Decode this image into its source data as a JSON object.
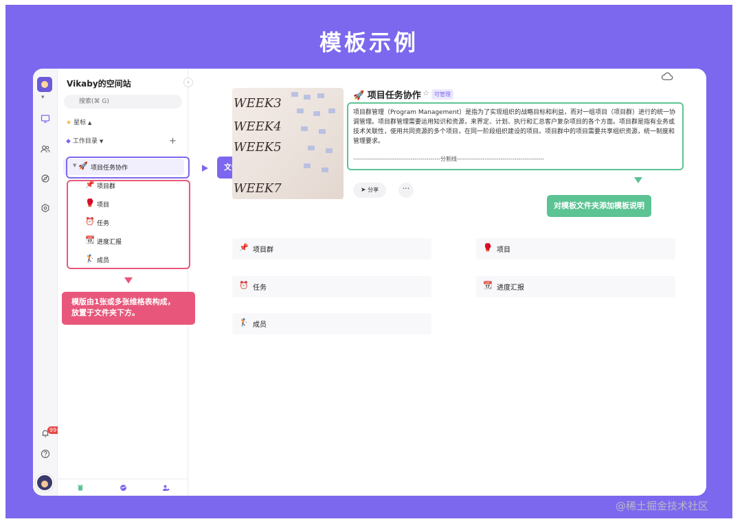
{
  "page_title": "模板示例",
  "workspace": {
    "name": "Vikaby的空间站",
    "search_placeholder": "搜索(⌘ G)",
    "starred_label": "星标",
    "catalog_label": "工作目录",
    "notification_count": "99+"
  },
  "folder": {
    "icon": "🚀",
    "label": "项目任务协作"
  },
  "sheets": [
    {
      "icon": "📌",
      "label": "项目群"
    },
    {
      "icon": "🥊",
      "label": "项目"
    },
    {
      "icon": "⏰",
      "label": "任务"
    },
    {
      "icon": "📆",
      "label": "进度汇报"
    },
    {
      "icon": "🏌",
      "label": "成员"
    }
  ],
  "annotations": {
    "folder_naming": "文件夹以模版名称命名",
    "sheets_note_line1": "模版由1张或多张维格表构成，",
    "sheets_note_line2": "放置于文件夹下方。",
    "description_note": "对模板文件夹添加模板说明"
  },
  "main": {
    "title": "🚀 项目任务协作",
    "permission_tag": "可管理",
    "description": "项目群管理（Program Management）是指为了实现组织的战略目标和利益，而对一组项目（项目群）进行的统一协调管理。项目群管理需要运用知识和资源，来界定、计划、执行和汇总客户复杂项目的各个方面。项目群是指有业务或技术关联性，使用共同资源的多个项目，在同一阶段组织建设的项目。项目群中的项目需要共享组织资源，统一制度和管理要求。",
    "divider_text": "--------------------------------------------分割线--------------------------------------------",
    "share_label": "分享",
    "more_label": "···",
    "cover_words": [
      "WEEK3",
      "WEEK4",
      "WEEK5",
      "WEEK7"
    ]
  },
  "cards": [
    {
      "icon": "📌",
      "label": "项目群"
    },
    {
      "icon": "🥊",
      "label": "项目"
    },
    {
      "icon": "⏰",
      "label": "任务"
    },
    {
      "icon": "📆",
      "label": "进度汇报"
    },
    {
      "icon": "🏌",
      "label": "成员"
    }
  ],
  "watermark": "@稀土掘金技术社区",
  "colors": {
    "brand": "#7B68EE",
    "pink": "#e8577b",
    "green": "#5cc393"
  },
  "icons": {
    "dashboard": "monitor-icon",
    "members": "people-icon",
    "explore": "compass-icon",
    "settings": "gear-icon",
    "notification": "bell-icon",
    "help": "help-icon",
    "trash": "trash-icon",
    "template": "template-icon",
    "invite": "invite-icon",
    "cloud": "cloud-sync-icon"
  }
}
